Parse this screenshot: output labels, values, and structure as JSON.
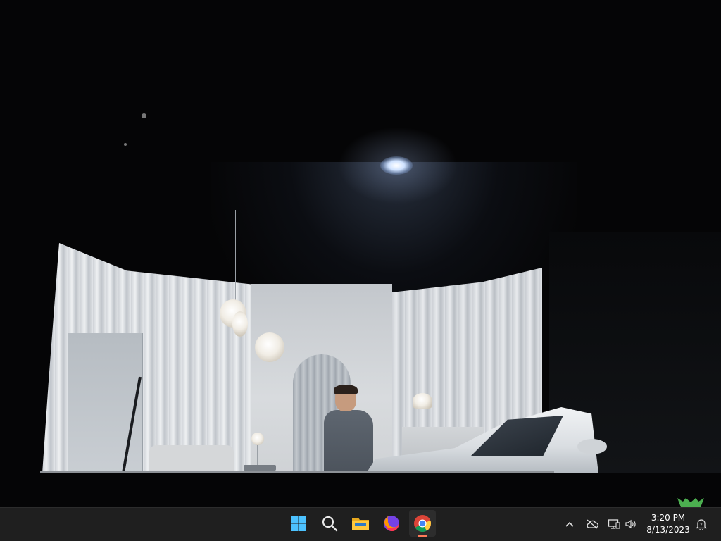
{
  "taskbar": {
    "apps": [
      {
        "name": "Start",
        "icon": "windows-logo-icon"
      },
      {
        "name": "Search",
        "icon": "search-icon"
      },
      {
        "name": "File Explorer",
        "icon": "folder-icon"
      },
      {
        "name": "Firefox",
        "icon": "firefox-icon"
      },
      {
        "name": "Google Chrome",
        "icon": "chrome-icon",
        "active": true
      }
    ],
    "tray": {
      "icons": [
        "chevron-up-icon",
        "cloud-offline-icon",
        "network-icon",
        "volume-icon",
        "notification-bell-icon"
      ]
    },
    "clock": {
      "time": "3:20 PM",
      "date": "8/13/2023"
    }
  },
  "colors": {
    "taskbar_bg": "#1f1f1f",
    "active_indicator": "#ff7a59",
    "windows_blue": "#4cc2ff",
    "logo_green": "#4caf50"
  }
}
